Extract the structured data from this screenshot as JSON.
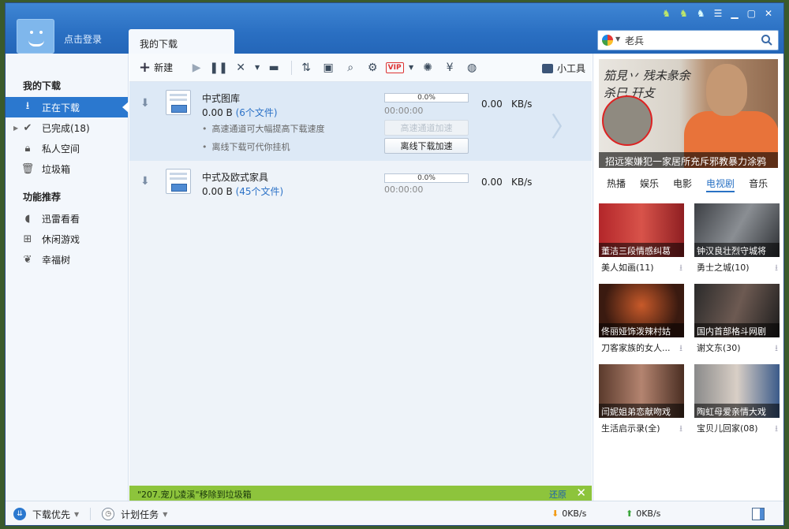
{
  "titlebar": {
    "login_label": "点击登录",
    "tab_label": "我的下载",
    "window_icons": [
      "skin-icon",
      "skin-icon",
      "skin-icon",
      "menu-icon",
      "minimize-icon",
      "maximize-icon",
      "close-icon"
    ]
  },
  "search": {
    "value": "老兵"
  },
  "sidebar": {
    "section_downloads": "我的下载",
    "items": [
      {
        "label": "正在下载",
        "icon": "download-icon",
        "active": true
      },
      {
        "label": "已完成(18)",
        "icon": "check-icon"
      },
      {
        "label": "私人空间",
        "icon": "lock-icon"
      },
      {
        "label": "垃圾箱",
        "icon": "trash-icon"
      }
    ],
    "section_features": "功能推荐",
    "features": [
      {
        "label": "迅雷看看",
        "icon": "play-icon"
      },
      {
        "label": "休闲游戏",
        "icon": "gamepad-icon"
      },
      {
        "label": "幸福树",
        "icon": "leaf-icon"
      }
    ]
  },
  "toolbar": {
    "new_label": "新建",
    "tools_label": "小工具"
  },
  "downloads": [
    {
      "name": "中式图库",
      "size": "0.00 B",
      "file_count": "(6个文件)",
      "progress_label": "0.0%",
      "progress_fraction": 0.0,
      "elapsed": "00:00:00",
      "speed": "0.00",
      "speed_unit": "KB/s",
      "tips": [
        "高速通道可大幅提高下载速度",
        "离线下载可代你挂机"
      ],
      "btn_fast": "高速通道加速",
      "btn_offline": "离线下载加速"
    },
    {
      "name": "中式及欧式家具",
      "size": "0.00 B",
      "file_count": "(45个文件)",
      "progress_label": "0.0%",
      "progress_fraction": 0.0,
      "elapsed": "00:00:00",
      "speed": "0.00",
      "speed_unit": "KB/s"
    }
  ],
  "notification": {
    "text": "\"207.宠儿凌溪\"移除到垃圾箱",
    "restore": "还原"
  },
  "right_panel": {
    "banner": {
      "handwriting": "笳見丷 残未彖余 杀巳 幵攴",
      "caption": "招远案嫌犯一家居所充斥邪教暴力涂鸦"
    },
    "tabs": [
      "热播",
      "娱乐",
      "电影",
      "电视剧",
      "音乐"
    ],
    "selected_tab": "电视剧",
    "cards": [
      {
        "thumb_caption": "董洁三段情感纠葛",
        "title": "美人如画(11)"
      },
      {
        "thumb_caption": "钟汉良壮烈守城将",
        "title": "勇士之城(10)"
      },
      {
        "thumb_caption": "佟丽娅饰泼辣村姑",
        "title": "刀客家族的女人..."
      },
      {
        "thumb_caption": "国内首部格斗网剧",
        "title": "谢文东(30)"
      },
      {
        "thumb_caption": "闫妮姐弟恋献吻戏",
        "title": "生活启示录(全)"
      },
      {
        "thumb_caption": "陶虹母爱亲情大戏",
        "title": "宝贝儿回家(08)"
      }
    ]
  },
  "statusbar": {
    "priority_label": "下载优先",
    "schedule_label": "计划任务",
    "down_speed": "0KB/s",
    "up_speed": "0KB/s"
  },
  "colors": {
    "accent": "#2b78cf",
    "titlebar": "#2a6fc2",
    "notify_bg": "#8dc43c"
  }
}
